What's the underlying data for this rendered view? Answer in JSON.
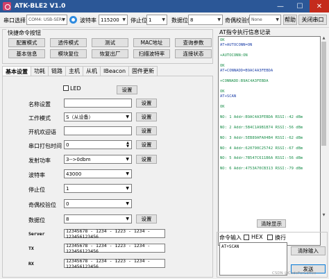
{
  "window": {
    "title": "ATK-BLE2 V1.0",
    "minimize": "—",
    "maximize": "☐",
    "close": "✕"
  },
  "toolbar": {
    "port_label": "串口选择",
    "port_value": "COM4: USB-SERI",
    "baud_label": "波特率",
    "baud_value": "115200",
    "stop_label": "停止位",
    "stop_value": "1",
    "data_label": "数据位",
    "data_value": "8",
    "parity_label": "奇偶校验位",
    "parity_value": "None",
    "help_label": "帮助",
    "close_port_label": "关闭串口"
  },
  "quick": {
    "title": "快捷命令按钮",
    "buttons": [
      "配置模式",
      "透传模式",
      "测试",
      "MAC地址",
      "查询参数",
      "基本信息",
      "模块复位",
      "恢复出厂",
      "扫描波特率",
      "连接状态"
    ]
  },
  "tabs": [
    "基本设置",
    "功耗",
    "链路",
    "主机",
    "从机",
    "IBeacon",
    "固件更新"
  ],
  "settings": {
    "led_label": "LED",
    "set_label": "设置",
    "name_label": "名称设置",
    "name_value": "",
    "mode_label": "工作模式",
    "mode_value": "S（从设备）",
    "greeting_label": "开机欢迎语",
    "greeting_value": "",
    "timeout_label": "串口打包时间",
    "timeout_value": "0",
    "power_label": "发射功率",
    "power_value": "3-->0dbm",
    "baud_label": "波特率",
    "baud_value": "43000",
    "stop_label": "停止位",
    "stop_value": "1",
    "parity_label": "奇偶校验位",
    "parity_value": "0",
    "data_label": "数据位",
    "data_value": "8",
    "server_label": "Server",
    "server_value": "12345678 - 1234 - 1223 - 1234 - 123456123456",
    "tx_label": "TX",
    "tx_value": "12345678 - 1234 - 1223 - 1234 - 123456123456",
    "rx_label": "RX",
    "rx_value": "12345678 - 1234 - 1223 - 1234 - 123456123456"
  },
  "log": {
    "title": "AT指令执行信息记录",
    "lines": [
      {
        "t": "OK",
        "k": "r"
      },
      {
        "t": "AT+AUTOCONN=ON",
        "k": "c"
      },
      {
        "t": "",
        "k": "r"
      },
      {
        "t": "+AUTOCONN:ON",
        "k": "r"
      },
      {
        "t": "",
        "k": "r"
      },
      {
        "t": "OK",
        "k": "r"
      },
      {
        "t": "AT+CONNADD=B9AC4A3FEBDA",
        "k": "c"
      },
      {
        "t": "",
        "k": "r"
      },
      {
        "t": "+CONNADD:B9AC4A3FEBDA",
        "k": "r"
      },
      {
        "t": "",
        "k": "r"
      },
      {
        "t": "OK",
        "k": "r"
      },
      {
        "t": "AT+SCAN",
        "k": "c"
      },
      {
        "t": "",
        "k": "r"
      },
      {
        "t": "OK",
        "k": "r"
      },
      {
        "t": "",
        "k": "r"
      },
      {
        "t": "NO: 1 Addr:B9AC4A3FEBDA RSSI:-42 dBm",
        "k": "r"
      },
      {
        "t": "",
        "k": "r"
      },
      {
        "t": "NO: 2 Addr:5B4C1A9B1B74 RSSI:-56 dBm",
        "k": "r"
      },
      {
        "t": "",
        "k": "r"
      },
      {
        "t": "NO: 3 Addr:5EB89AFA04B4 RSSI:-62 dBm",
        "k": "r"
      },
      {
        "t": "",
        "k": "r"
      },
      {
        "t": "NO: 4 Addr:620790C25742 RSSI:-67 dBm",
        "k": "r"
      },
      {
        "t": "",
        "k": "r"
      },
      {
        "t": "NO: 5 Addr:7B547C611B6A RSSI:-56 dBm",
        "k": "r"
      },
      {
        "t": "",
        "k": "r"
      },
      {
        "t": "NO: 6 Addr:4753A70CB313 RSSI:-79 dBm",
        "k": "r"
      }
    ],
    "clear_label": "清除显示"
  },
  "cmd": {
    "input_label": "命令输入",
    "hex_label": "HEX",
    "newline_label": "换行",
    "value": "AT+SCAN",
    "clear_label": "清除输入",
    "send_label": "发送"
  },
  "watermark": "CSDN @CodeForCoffee"
}
